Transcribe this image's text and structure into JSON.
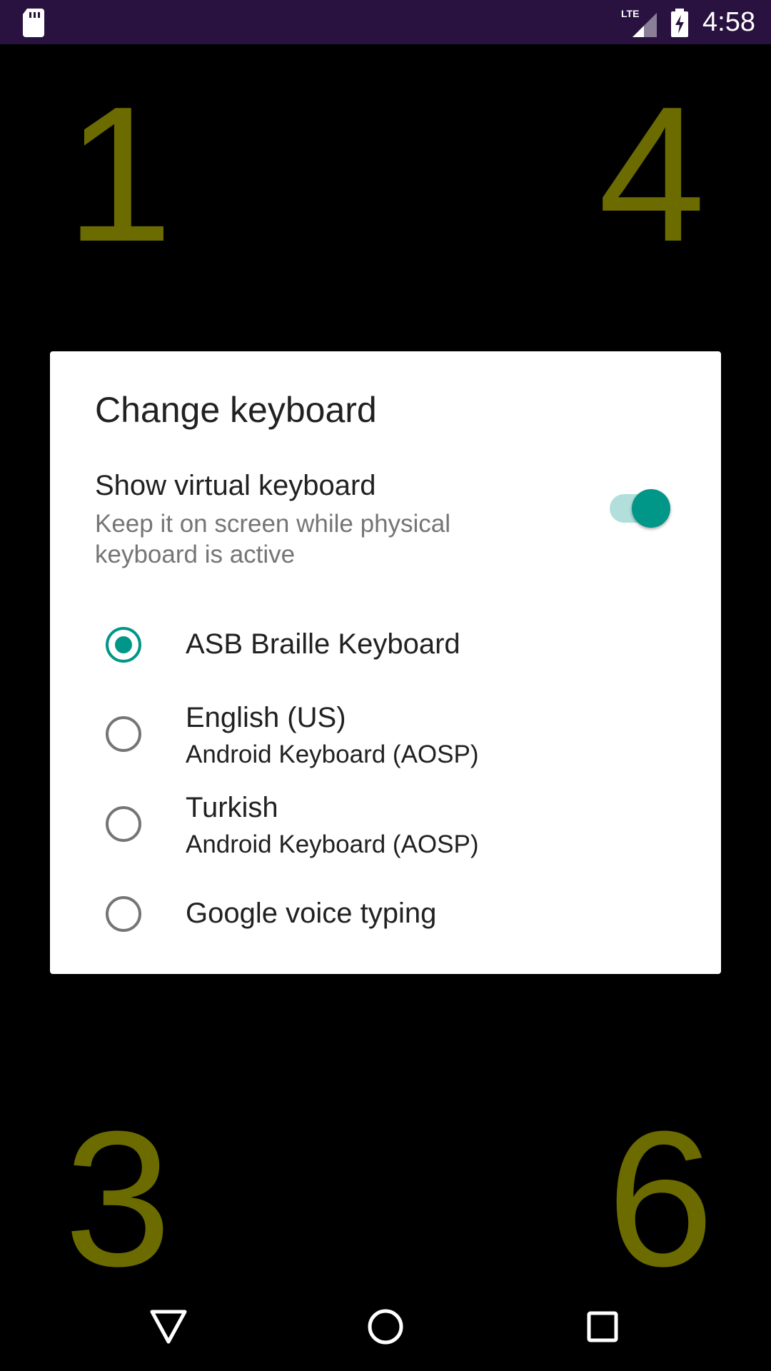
{
  "status_bar": {
    "time": "4:58",
    "network_label": "LTE",
    "icons": [
      "sd-card-icon",
      "lte-signal-icon",
      "battery-charging-icon"
    ]
  },
  "background_dots": {
    "top_left": "1",
    "top_right": "4",
    "bottom_left": "3",
    "bottom_right": "6"
  },
  "dialog": {
    "title": "Change keyboard",
    "toggle": {
      "title": "Show virtual keyboard",
      "subtitle": "Keep it on screen while physical keyboard is active",
      "checked": true
    },
    "options": [
      {
        "label": "ASB Braille Keyboard",
        "sub": "",
        "selected": true
      },
      {
        "label": "English (US)",
        "sub": "Android Keyboard (AOSP)",
        "selected": false
      },
      {
        "label": "Turkish",
        "sub": "Android Keyboard (AOSP)",
        "selected": false
      },
      {
        "label": "Google voice typing",
        "sub": "",
        "selected": false
      }
    ]
  },
  "nav_bar": {
    "icons": [
      "back-icon",
      "home-icon",
      "recents-icon"
    ]
  },
  "colors": {
    "status_bar": "#2a1240",
    "accent": "#009688",
    "dot_numbers": "#6b6b00"
  }
}
